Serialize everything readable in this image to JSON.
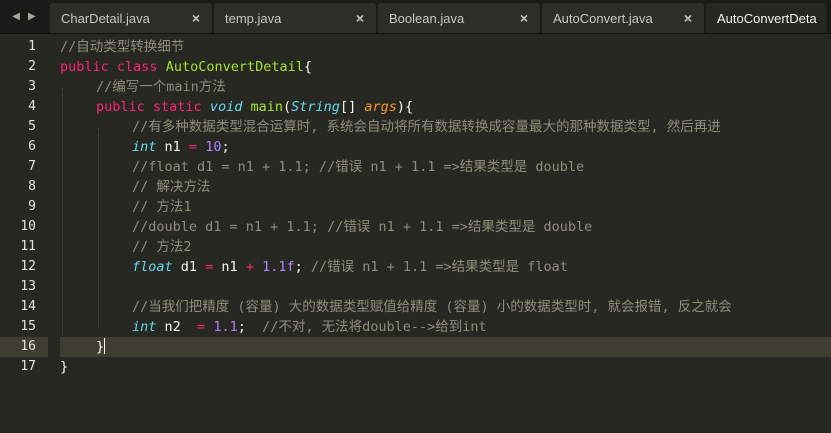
{
  "tabs": [
    {
      "label": "CharDetail.java",
      "close": "×"
    },
    {
      "label": "temp.java",
      "close": "×"
    },
    {
      "label": "Boolean.java",
      "close": "×"
    },
    {
      "label": "AutoConvert.java",
      "close": "×"
    },
    {
      "label": "AutoConvertDeta",
      "active": true
    }
  ],
  "nav": {
    "left": "◀",
    "right": "▶"
  },
  "line_numbers": [
    "1",
    "2",
    "3",
    "4",
    "5",
    "6",
    "7",
    "8",
    "9",
    "10",
    "11",
    "12",
    "13",
    "14",
    "15",
    "16",
    "17"
  ],
  "current_line": 16,
  "code": {
    "l1": {
      "comment": "//自动类型转换细节"
    },
    "l2": {
      "kw1": "public",
      "kw2": "class",
      "name": "AutoConvertDetail",
      "rest": "{"
    },
    "l3": {
      "comment": "//编写一个main方法"
    },
    "l4": {
      "kw1": "public",
      "kw2": "static",
      "type": "void",
      "fn": "main",
      "p1": "(",
      "ptype": "String",
      "p2": "[] ",
      "param": "args",
      "p3": "){"
    },
    "l5": {
      "comment": "//有多种数据类型混合运算时, 系统会自动将所有数据转换成容量最大的那种数据类型, 然后再进"
    },
    "l6": {
      "type": "int",
      "a": " n1 ",
      "op": "=",
      "sp": " ",
      "num": "10",
      "end": ";"
    },
    "l7": {
      "comment": "//float d1 = n1 + 1.1; //错误 n1 + 1.1 =>结果类型是 double"
    },
    "l8": {
      "comment": "// 解决方法"
    },
    "l9": {
      "comment": "// 方法1"
    },
    "l10": {
      "comment": "//double d1 = n1 + 1.1; //错误 n1 + 1.1 =>结果类型是 double"
    },
    "l11": {
      "comment": "// 方法2"
    },
    "l12": {
      "type": "float",
      "a": " d1 ",
      "op1": "=",
      "b": " n1 ",
      "op2": "+",
      "sp": " ",
      "num": "1.1f",
      "end": "; ",
      "comment": "//错误 n1 + 1.1 =>结果类型是 float"
    },
    "l14": {
      "comment": "//当我们把精度 (容量) 大的数据类型赋值给精度 (容量) 小的数据类型时, 就会报错, 反之就会"
    },
    "l15": {
      "type": "int",
      "a": " n2  ",
      "op": "=",
      "sp": " ",
      "num": "1.1",
      "end": ";  ",
      "comment": "//不对, 无法将double-->给到int"
    },
    "l16": {
      "text": "}"
    },
    "l17": {
      "text": "}"
    }
  },
  "colors": {
    "background": "#272822",
    "comment": "#8f8d7c",
    "keyword": "#f92672",
    "type": "#66d9ef",
    "class_name": "#a6e22e",
    "number": "#ae81ff",
    "parameter": "#fd971f"
  }
}
